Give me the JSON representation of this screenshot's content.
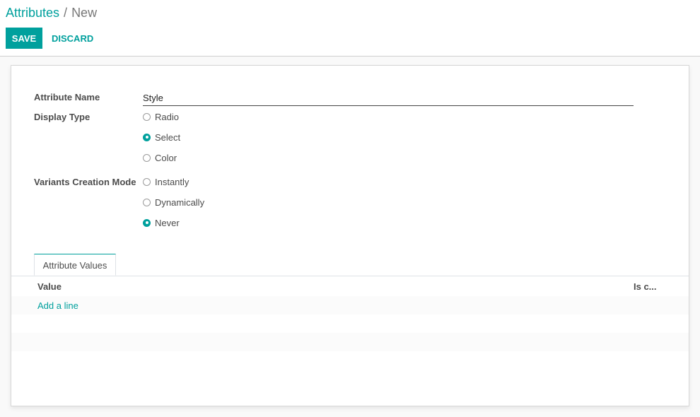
{
  "breadcrumb": {
    "parent": "Attributes",
    "separator": "/",
    "current": "New"
  },
  "toolbar": {
    "save_label": "SAVE",
    "discard_label": "DISCARD"
  },
  "form": {
    "name_label": "Attribute Name",
    "name_value": "Style",
    "display_type": {
      "label": "Display Type",
      "options": [
        "Radio",
        "Select",
        "Color"
      ],
      "selected": "Select"
    },
    "variants_mode": {
      "label": "Variants Creation Mode",
      "options": [
        "Instantly",
        "Dynamically",
        "Never"
      ],
      "selected": "Never"
    }
  },
  "tabs": [
    {
      "label": "Attribute Values"
    }
  ],
  "table": {
    "columns": [
      "Value",
      "Is c..."
    ],
    "add_line": "Add a line"
  },
  "colors": {
    "accent": "#00a09d",
    "text": "#4c4c4c",
    "background": "#f9f9f9"
  }
}
